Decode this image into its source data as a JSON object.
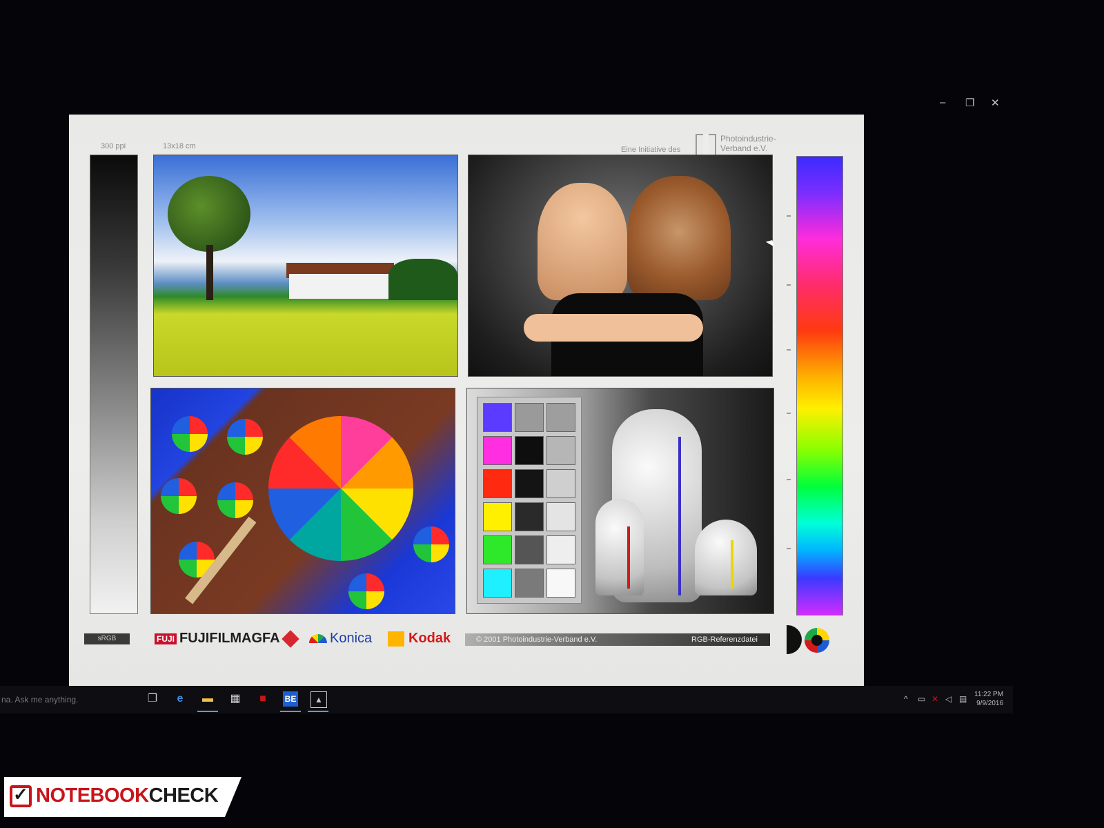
{
  "window_controls": {
    "minimize": "–",
    "maximize": "❐",
    "close": "✕"
  },
  "sheet": {
    "label_ppi": "300 ppi",
    "label_size": "13x18 cm",
    "initiative": "Eine Initiative des",
    "org_line1": "Photoindustrie-",
    "org_line2": "Verband e.V.",
    "srgb": "sRGB",
    "brands": {
      "fujifilm": "FUJIFILM",
      "fuji_mark": "FUJI",
      "agfa": "AGFA",
      "konica": "Konica",
      "kodak": "Kodak"
    },
    "copyright": "© 2001 Photoindustrie-Verband e.V.",
    "file_label": "RGB-Referenzdatei"
  },
  "patches": {
    "colors": [
      "#5a3bff",
      "#ff2ee0",
      "#ff2a10",
      "#fff000",
      "#2ee82a",
      "#1ef0ff"
    ],
    "grays_mid": [
      "#9a9a9a",
      "#0e0e0e",
      "#141414",
      "#2a2a2a",
      "#555555",
      "#7a7a7a"
    ],
    "grays_right": [
      "#9e9e9e",
      "#b6b6b6",
      "#cfcfcf",
      "#e4e4e4",
      "#eeeeee",
      "#f8f8f8"
    ]
  },
  "taskbar": {
    "search_placeholder": "na. Ask me anything.",
    "icons": [
      "task-view",
      "edge",
      "file-explorer",
      "store",
      "app-red",
      "be-app",
      "photos"
    ],
    "be_label": "BE",
    "tray_caret": "^",
    "time": "11:22 PM",
    "date": "9/9/2016"
  },
  "watermark": {
    "part1": "NOTEBOOK",
    "part2": "CHECK"
  }
}
